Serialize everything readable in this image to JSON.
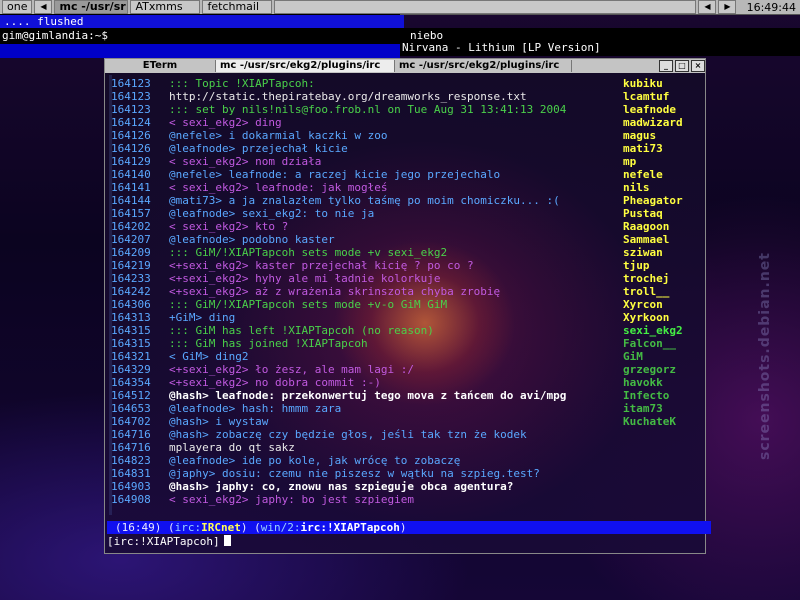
{
  "taskbar": {
    "items": [
      {
        "label": "one",
        "active": false
      },
      {
        "label": "mc -/usr/sr",
        "active": true
      },
      {
        "label": "ATxmms",
        "active": false
      },
      {
        "label": "fetchmail",
        "active": false
      }
    ],
    "clock": "16:49:44"
  },
  "dock": {
    "line1": ".... flushed",
    "line2": "gim@gimlandia:~$"
  },
  "info": {
    "line1": "niebo",
    "line2": "Nirvana - Lithium [LP Version]"
  },
  "terminal": {
    "tabs": [
      "ETerm",
      "mc -/usr/src/ekg2/plugins/irc",
      "mc -/usr/src/ekg2/plugins/irc"
    ],
    "lines": [
      {
        "ts": "164123",
        "text": "::: Topic !XIAPTapcoh:",
        "style": "sys"
      },
      {
        "ts": "164123",
        "text": "http://static.thepiratebay.org/dreamworks_response.txt",
        "style": "link"
      },
      {
        "ts": "164123",
        "text": "::: set by nils!nils@foo.frob.nl on Tue Aug 31 13:41:13 2004",
        "style": "sys"
      },
      {
        "ts": "164124",
        "text": "< sexi_ekg2> ding",
        "style": "self"
      },
      {
        "ts": "164126",
        "text": " @nefele> i dokarmial kaczki w zoo",
        "style": "other"
      },
      {
        "ts": "164126",
        "text": " @leafnode> przejechał kicie",
        "style": "other"
      },
      {
        "ts": "164129",
        "text": "< sexi_ekg2> nom działa",
        "style": "self"
      },
      {
        "ts": "164140",
        "text": " @nefele> leafnode: a raczej kicie jego przejechalo",
        "style": "other"
      },
      {
        "ts": "164141",
        "text": "< sexi_ekg2> leafnode: jak mogłeś",
        "style": "self"
      },
      {
        "ts": "164144",
        "text": " @mati73> a ja znalazłem tylko taśmę po moim chomiczku... :(",
        "style": "other"
      },
      {
        "ts": "164157",
        "text": " @leafnode> sexi_ekg2: to nie ja",
        "style": "other"
      },
      {
        "ts": "164202",
        "text": "< sexi_ekg2> kto ?",
        "style": "self"
      },
      {
        "ts": "164207",
        "text": " @leafnode> podobno kaster",
        "style": "other"
      },
      {
        "ts": "164209",
        "text": "::: GiM/!XIAPTapcoh sets mode +v sexi_ekg2",
        "style": "sys"
      },
      {
        "ts": "164219",
        "text": "<+sexi_ekg2> kaster przejechał kicię ? po co ?",
        "style": "self"
      },
      {
        "ts": "164233",
        "text": "<+sexi_ekg2> hyhy ale mi ładnie kolorkuje",
        "style": "self"
      },
      {
        "ts": "164242",
        "text": "<+sexi_ekg2> aż z wrażenia skrinszota chyba zrobię",
        "style": "self"
      },
      {
        "ts": "164306",
        "text": "::: GiM/!XIAPTapcoh sets mode +v-o GiM GiM",
        "style": "sys"
      },
      {
        "ts": "164313",
        "text": " +GiM> ding",
        "style": "other"
      },
      {
        "ts": "164315",
        "text": "::: GiM has left !XIAPTapcoh (no reason)",
        "style": "sys"
      },
      {
        "ts": "164315",
        "text": "::: GiM has joined !XIAPTapcoh",
        "style": "sys"
      },
      {
        "ts": "164321",
        "text": " < GiM> ding2",
        "style": "other"
      },
      {
        "ts": "164329",
        "text": "<+sexi_ekg2> ło żesz, ale mam lagi :/",
        "style": "self"
      },
      {
        "ts": "164354",
        "text": "<+sexi_ekg2> no dobra commit :-)",
        "style": "self"
      },
      {
        "ts": "164512",
        "text": " @hash> leafnode: przekonwertuj tego mova z tańcem do avi/mpg",
        "style": "hl"
      },
      {
        "ts": "164653",
        "text": " @leafnode> hash: hmmm zara",
        "style": "other"
      },
      {
        "ts": "164702",
        "text": " @hash> i wystaw",
        "style": "other"
      },
      {
        "ts": "164716",
        "text": " @hash> zobaczę czy będzie głos, jeśli tak tzn że kodek",
        "style": "other"
      },
      {
        "ts": "164716",
        "text": "mplayera do qt sakz",
        "style": "link"
      },
      {
        "ts": "164823",
        "text": " @leafnode> ide po kole, jak wrócę to zobaczę",
        "style": "other"
      },
      {
        "ts": "164831",
        "text": " @japhy> dosiu: czemu nie piszesz w wątku na szpieg.test?",
        "style": "other"
      },
      {
        "ts": "164903",
        "text": " @hash> japhy: co, znowu nas szpieguje obca agentura?",
        "style": "hl"
      },
      {
        "ts": "164908",
        "text": "< sexi_ekg2> japhy: bo jest szpiegiem",
        "style": "self"
      }
    ],
    "nicklist": [
      {
        "name": "kubiku",
        "color": "#ffff40"
      },
      {
        "name": "lcamtuf",
        "color": "#ffff40"
      },
      {
        "name": "leafnode",
        "color": "#ffff40"
      },
      {
        "name": "madwizard",
        "color": "#ffff40"
      },
      {
        "name": "magus",
        "color": "#ffff40"
      },
      {
        "name": "mati73",
        "color": "#ffff40"
      },
      {
        "name": "mp",
        "color": "#ffff40"
      },
      {
        "name": "nefele",
        "color": "#ffff40"
      },
      {
        "name": "nils",
        "color": "#ffff40"
      },
      {
        "name": "Pheagator",
        "color": "#ffff40"
      },
      {
        "name": "Pustaq",
        "color": "#ffff40"
      },
      {
        "name": "Raagoon",
        "color": "#ffff40"
      },
      {
        "name": "Sammael",
        "color": "#ffff40"
      },
      {
        "name": "sziwan",
        "color": "#ffff40"
      },
      {
        "name": "tjup",
        "color": "#ffff40"
      },
      {
        "name": "trochej",
        "color": "#ffff40"
      },
      {
        "name": "troll__",
        "color": "#ffff40"
      },
      {
        "name": "Xyrcon",
        "color": "#ffff40"
      },
      {
        "name": "Xyrkoon",
        "color": "#ffff40"
      },
      {
        "name": "sexi_ekg2",
        "color": "#44ee44"
      },
      {
        "name": "Falcon__",
        "color": "#44bb44"
      },
      {
        "name": "GiM",
        "color": "#44bb44"
      },
      {
        "name": "grzegorz",
        "color": "#44bb44"
      },
      {
        "name": "havokk",
        "color": "#44bb44"
      },
      {
        "name": "Infecto",
        "color": "#44bb44"
      },
      {
        "name": "itam73",
        "color": "#44bb44"
      },
      {
        "name": "KuchateK",
        "color": "#44bb44"
      }
    ],
    "status": {
      "time": "16:49",
      "net_prefix": "irc:",
      "net": "IRCnet",
      "win_prefix": "win/2:",
      "win": "irc:!XIAPTapcoh"
    },
    "prompt": "[irc:!XIAPTapcoh]"
  },
  "watermark": "screenshots.debian.net"
}
